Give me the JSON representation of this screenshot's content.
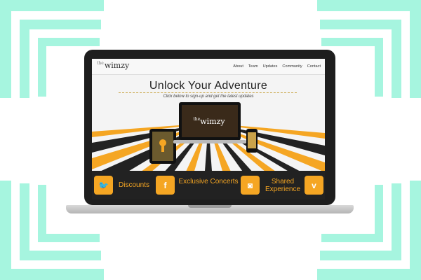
{
  "site": {
    "logo_prefix": "the",
    "logo_name": "wimzy",
    "nav": [
      "About",
      "Team",
      "Updates",
      "Community",
      "Contact"
    ],
    "headline": "Unlock Your Adventure",
    "subline": "Click below to sign-up and get the latest updates",
    "device_logo_prefix": "the",
    "device_logo_name": "wimzy"
  },
  "features": [
    {
      "icon": "twitter-icon",
      "label": "Discounts"
    },
    {
      "icon": "facebook-icon",
      "label": "Exclusive Concerts"
    },
    {
      "icon": "instagram-icon",
      "label": "Shared Experience"
    },
    {
      "icon": "vimeo-icon",
      "label": ""
    }
  ],
  "colors": {
    "accent": "#f5a623",
    "frame_mint": "#a6f5df",
    "dark": "#222222"
  }
}
